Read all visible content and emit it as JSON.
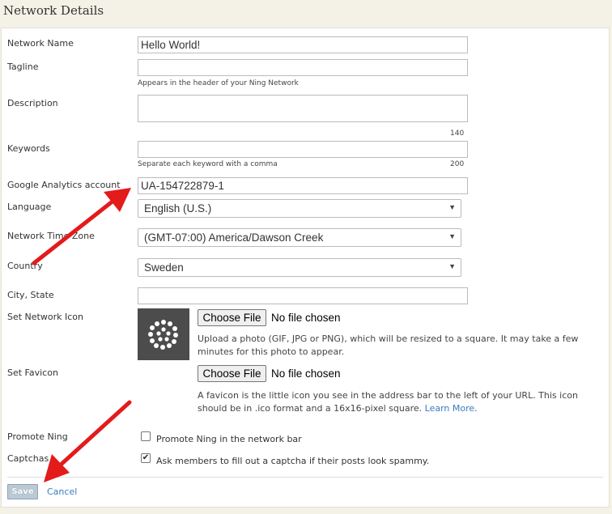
{
  "page": {
    "title": "Network Details"
  },
  "form": {
    "network_name": {
      "label": "Network Name",
      "value": "Hello World!"
    },
    "tagline": {
      "label": "Tagline",
      "value": "",
      "hint": "Appears in the header of your Ning Network"
    },
    "description": {
      "label": "Description",
      "value": "",
      "counter": "140"
    },
    "keywords": {
      "label": "Keywords",
      "value": "",
      "hint": "Separate each keyword with a comma",
      "counter": "200"
    },
    "analytics": {
      "label": "Google Analytics account",
      "value": "UA-154722879-1"
    },
    "language": {
      "label": "Language",
      "selected": "English (U.S.)"
    },
    "timezone": {
      "label": "Network Time Zone",
      "selected": "(GMT-07:00) America/Dawson Creek"
    },
    "country": {
      "label": "Country",
      "selected": "Sweden"
    },
    "city_state": {
      "label": "City, State",
      "value": ""
    },
    "network_icon": {
      "label": "Set Network Icon",
      "button": "Choose File",
      "status": "No file chosen",
      "description": "Upload a photo (GIF, JPG or PNG), which will be resized to a square. It may take a few minutes for this photo to appear."
    },
    "favicon": {
      "label": "Set Favicon",
      "button": "Choose File",
      "status": "No file chosen",
      "description": "A favicon is the little icon you see in the address bar to the left of your URL. This icon should be in .ico format and a 16x16-pixel square.",
      "learn_more": "Learn More"
    },
    "promote": {
      "label": "Promote Ning",
      "checkbox_label": "Promote Ning in the network bar",
      "checked": false
    },
    "captchas": {
      "label": "Captchas",
      "checkbox_label": "Ask members to fill out a captcha if their posts look spammy.",
      "checked": true
    }
  },
  "actions": {
    "save": "Save",
    "cancel": "Cancel"
  },
  "colors": {
    "annotation_arrow": "#e31b1b",
    "link": "#3b7bbf",
    "save_button": "#bac9d6"
  },
  "icons": {
    "dropdown": "chevron-down-icon",
    "network_icon_preview": "dotted-circle-icon",
    "checkmark": "checkmark-icon"
  }
}
